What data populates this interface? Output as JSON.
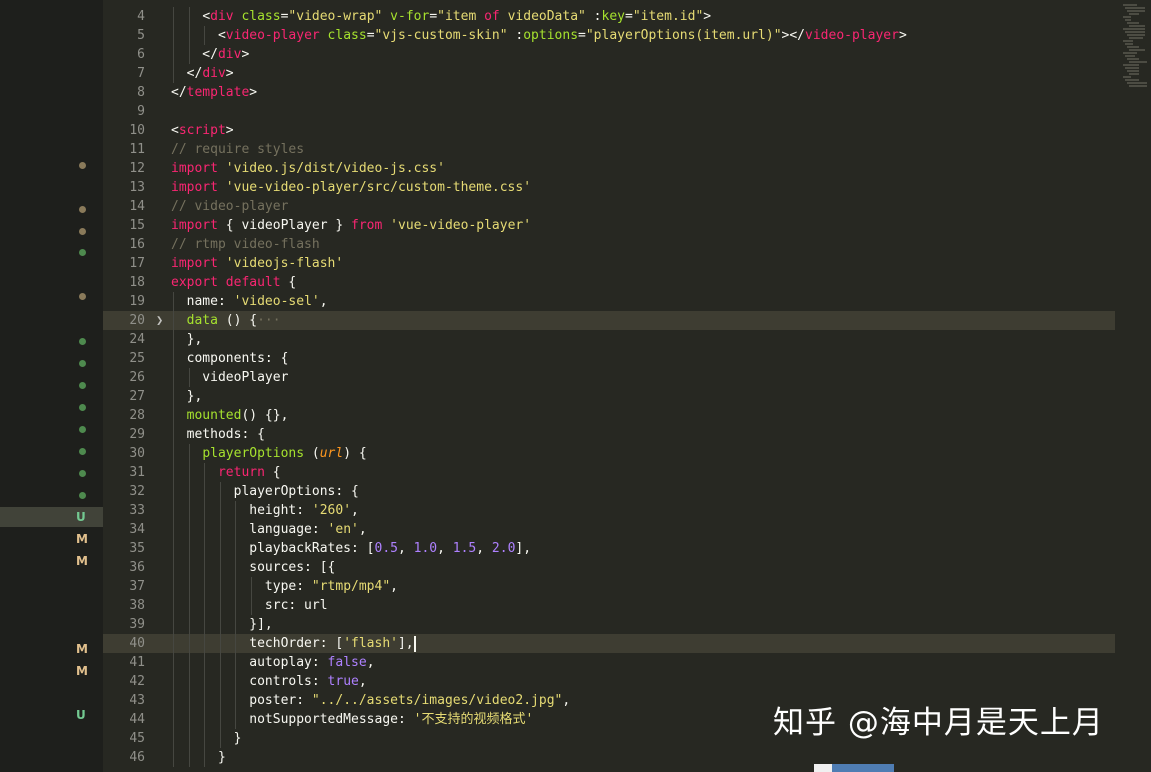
{
  "scm_status": {
    "letters": [
      "U",
      "M",
      "M",
      "M",
      "M",
      "U"
    ]
  },
  "colors": {
    "editor_bg": "#272822",
    "line_highlight": "#3e3d32",
    "keyword": "#f92672",
    "function": "#a6e22e",
    "string": "#e6db74",
    "comment": "#75715e",
    "number": "#ae81ff"
  },
  "code": {
    "lines": [
      {
        "num": "4",
        "parts": [
          {
            "t": "    "
          },
          {
            "t": "<",
            "c": "w"
          },
          {
            "t": "div",
            "c": "t"
          },
          {
            "t": " "
          },
          {
            "t": "class",
            "c": "a"
          },
          {
            "t": "="
          },
          {
            "t": "\"video-wrap\"",
            "c": "s"
          },
          {
            "t": " "
          },
          {
            "t": "v-for",
            "c": "a"
          },
          {
            "t": "="
          },
          {
            "t": "\"item ",
            "c": "s"
          },
          {
            "t": "of",
            "c": "t"
          },
          {
            "t": " videoData\"",
            "c": "s"
          },
          {
            "t": " :"
          },
          {
            "t": "key",
            "c": "a"
          },
          {
            "t": "="
          },
          {
            "t": "\"item.id\"",
            "c": "s"
          },
          {
            "t": ">"
          }
        ]
      },
      {
        "num": "5",
        "parts": [
          {
            "t": "      <"
          },
          {
            "t": "video-player",
            "c": "t"
          },
          {
            "t": " "
          },
          {
            "t": "class",
            "c": "a"
          },
          {
            "t": "="
          },
          {
            "t": "\"vjs-custom-skin\"",
            "c": "s"
          },
          {
            "t": " :"
          },
          {
            "t": "options",
            "c": "a"
          },
          {
            "t": "="
          },
          {
            "t": "\"playerOptions(item.url)\"",
            "c": "s"
          },
          {
            "t": "></"
          },
          {
            "t": "video-player",
            "c": "t"
          },
          {
            "t": ">"
          }
        ]
      },
      {
        "num": "6",
        "parts": [
          {
            "t": "    </"
          },
          {
            "t": "div",
            "c": "t"
          },
          {
            "t": ">"
          }
        ]
      },
      {
        "num": "7",
        "parts": [
          {
            "t": "  </"
          },
          {
            "t": "div",
            "c": "t"
          },
          {
            "t": ">"
          }
        ]
      },
      {
        "num": "8",
        "parts": [
          {
            "t": "</"
          },
          {
            "t": "template",
            "c": "t"
          },
          {
            "t": ">"
          }
        ]
      },
      {
        "num": "9",
        "parts": []
      },
      {
        "num": "10",
        "parts": [
          {
            "t": "<"
          },
          {
            "t": "script",
            "c": "t"
          },
          {
            "t": ">"
          }
        ]
      },
      {
        "num": "11",
        "parts": [
          {
            "t": "// require styles",
            "c": "c"
          }
        ]
      },
      {
        "num": "12",
        "parts": [
          {
            "t": "import",
            "c": "t"
          },
          {
            "t": " "
          },
          {
            "t": "'video.js/dist/video-js.css'",
            "c": "s"
          }
        ]
      },
      {
        "num": "13",
        "parts": [
          {
            "t": "import",
            "c": "t"
          },
          {
            "t": " "
          },
          {
            "t": "'vue-video-player/src/custom-theme.css'",
            "c": "s"
          }
        ]
      },
      {
        "num": "14",
        "parts": [
          {
            "t": "// video-player",
            "c": "c"
          }
        ]
      },
      {
        "num": "15",
        "parts": [
          {
            "t": "import",
            "c": "t"
          },
          {
            "t": " { videoPlayer } "
          },
          {
            "t": "from",
            "c": "t"
          },
          {
            "t": " "
          },
          {
            "t": "'vue-video-player'",
            "c": "s"
          }
        ]
      },
      {
        "num": "16",
        "parts": [
          {
            "t": "// rtmp video-flash",
            "c": "c"
          }
        ]
      },
      {
        "num": "17",
        "parts": [
          {
            "t": "import",
            "c": "t"
          },
          {
            "t": " "
          },
          {
            "t": "'videojs-flash'",
            "c": "s"
          }
        ]
      },
      {
        "num": "18",
        "parts": [
          {
            "t": "export",
            "c": "t"
          },
          {
            "t": " "
          },
          {
            "t": "default",
            "c": "t"
          },
          {
            "t": " {"
          }
        ]
      },
      {
        "num": "19",
        "parts": [
          {
            "t": "  name: "
          },
          {
            "t": "'video-sel'",
            "c": "s"
          },
          {
            "t": ","
          }
        ]
      },
      {
        "num": "20",
        "parts": [
          {
            "t": "  "
          },
          {
            "t": "data",
            "c": "a"
          },
          {
            "t": " () {"
          },
          {
            "t": "···",
            "c": "dots"
          }
        ]
      },
      {
        "num": "24",
        "parts": [
          {
            "t": "  },"
          }
        ]
      },
      {
        "num": "25",
        "parts": [
          {
            "t": "  components: {"
          }
        ]
      },
      {
        "num": "26",
        "parts": [
          {
            "t": "    videoPlayer"
          }
        ]
      },
      {
        "num": "27",
        "parts": [
          {
            "t": "  },"
          }
        ]
      },
      {
        "num": "28",
        "parts": [
          {
            "t": "  "
          },
          {
            "t": "mounted",
            "c": "a"
          },
          {
            "t": "() {},"
          }
        ]
      },
      {
        "num": "29",
        "parts": [
          {
            "t": "  methods: {"
          }
        ]
      },
      {
        "num": "30",
        "parts": [
          {
            "t": "    "
          },
          {
            "t": "playerOptions",
            "c": "a"
          },
          {
            "t": " ("
          },
          {
            "t": "url",
            "c": "p"
          },
          {
            "t": ") {"
          }
        ]
      },
      {
        "num": "31",
        "parts": [
          {
            "t": "      "
          },
          {
            "t": "return",
            "c": "t"
          },
          {
            "t": " {"
          }
        ]
      },
      {
        "num": "32",
        "parts": [
          {
            "t": "        playerOptions: {"
          }
        ]
      },
      {
        "num": "33",
        "parts": [
          {
            "t": "          height: "
          },
          {
            "t": "'260'",
            "c": "s"
          },
          {
            "t": ","
          }
        ]
      },
      {
        "num": "34",
        "parts": [
          {
            "t": "          language: "
          },
          {
            "t": "'en'",
            "c": "s"
          },
          {
            "t": ","
          }
        ]
      },
      {
        "num": "35",
        "parts": [
          {
            "t": "          playbackRates: ["
          },
          {
            "t": "0.5",
            "c": "n"
          },
          {
            "t": ", "
          },
          {
            "t": "1.0",
            "c": "n"
          },
          {
            "t": ", "
          },
          {
            "t": "1.5",
            "c": "n"
          },
          {
            "t": ", "
          },
          {
            "t": "2.0",
            "c": "n"
          },
          {
            "t": "],"
          }
        ]
      },
      {
        "num": "36",
        "parts": [
          {
            "t": "          sources: [{"
          }
        ]
      },
      {
        "num": "37",
        "parts": [
          {
            "t": "            type: "
          },
          {
            "t": "\"rtmp/mp4\"",
            "c": "s"
          },
          {
            "t": ","
          }
        ]
      },
      {
        "num": "38",
        "parts": [
          {
            "t": "            src: url"
          }
        ]
      },
      {
        "num": "39",
        "parts": [
          {
            "t": "          }],"
          }
        ]
      },
      {
        "num": "40",
        "parts": [
          {
            "t": "          techOrder: ["
          },
          {
            "t": "'flash'",
            "c": "s"
          },
          {
            "t": "],"
          }
        ]
      },
      {
        "num": "41",
        "parts": [
          {
            "t": "          autoplay: "
          },
          {
            "t": "false",
            "c": "n"
          },
          {
            "t": ","
          }
        ]
      },
      {
        "num": "42",
        "parts": [
          {
            "t": "          controls: "
          },
          {
            "t": "true",
            "c": "n"
          },
          {
            "t": ","
          }
        ]
      },
      {
        "num": "43",
        "parts": [
          {
            "t": "          poster: "
          },
          {
            "t": "\"../../assets/images/video2.jpg\"",
            "c": "s"
          },
          {
            "t": ","
          }
        ]
      },
      {
        "num": "44",
        "parts": [
          {
            "t": "          notSupportedMessage: "
          },
          {
            "t": "'不支持的视频格式'",
            "c": "s"
          }
        ]
      },
      {
        "num": "45",
        "parts": [
          {
            "t": "        }"
          }
        ]
      },
      {
        "num": "46",
        "parts": [
          {
            "t": "      }"
          }
        ]
      }
    ]
  },
  "watermark": {
    "text": "知乎 @海中月是天上月"
  }
}
